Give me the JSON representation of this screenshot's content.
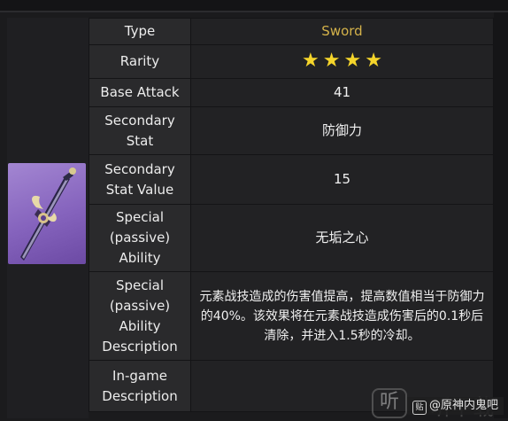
{
  "table": {
    "type_label": "Type",
    "type_value": "Sword",
    "rarity_label": "Rarity",
    "rarity_stars": 4,
    "base_attack_label": "Base Attack",
    "base_attack_value": "41",
    "secondary_stat_label": "Secondary Stat",
    "secondary_stat_value": "防御力",
    "secondary_stat_value_label": "Secondary Stat Value",
    "secondary_stat_value_value": "15",
    "passive_label": "Special (passive) Ability",
    "passive_value": "无垢之心",
    "passive_desc_label": "Special (passive) Ability Description",
    "passive_desc_value": "元素战技造成的伤害值提高，提高数值相当于防御力的40%。该效果将在元素战技造成伤害后的0.1秒后清除，并进入1.5秒的冷却。",
    "ingame_desc_label": "In-game Description",
    "ingame_desc_value": ""
  },
  "watermark": {
    "logo_glyph": "听",
    "partial_text": "听下载",
    "attribution": "@原神内鬼吧",
    "attribution_icon": "贴"
  },
  "colors": {
    "type_value": "#d4b24a",
    "star": "#f5d52b",
    "weapon_bg": "#8563bd"
  },
  "icons": {
    "star": "star-icon",
    "weapon": "sword-weapon-image"
  }
}
